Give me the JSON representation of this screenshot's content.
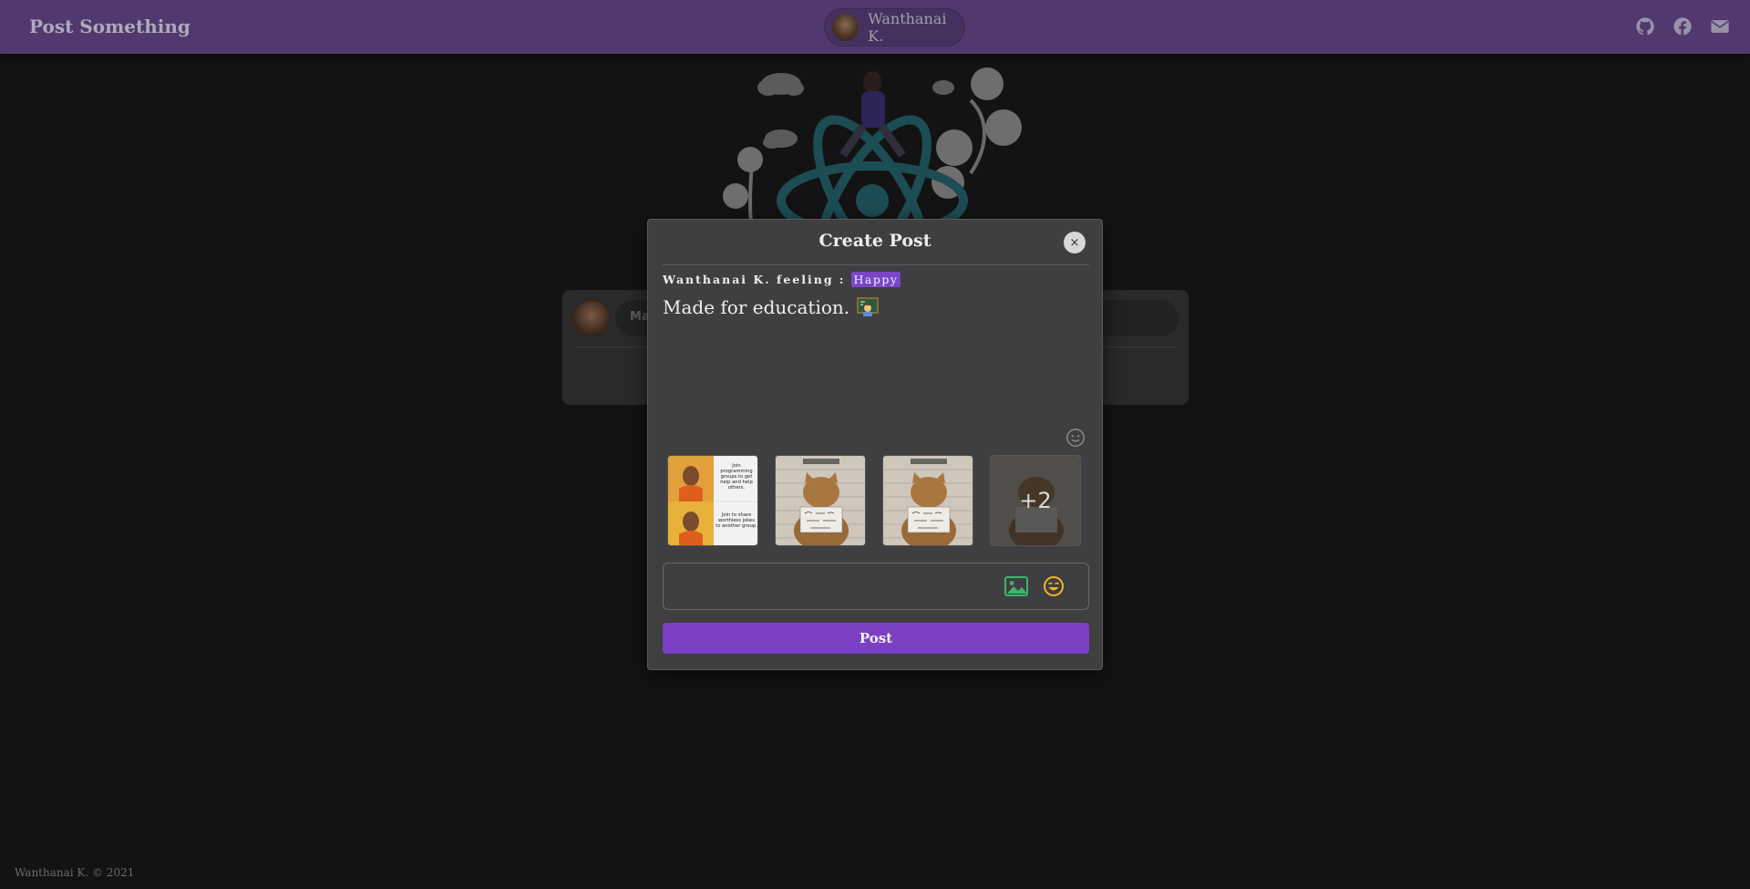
{
  "header": {
    "brand": "Post Something",
    "user_name": "Wanthanai K.",
    "icons": [
      "github-icon",
      "facebook-icon",
      "mail-icon"
    ]
  },
  "background_card": {
    "input_placeholder": "Ma"
  },
  "modal": {
    "title": "Create Post",
    "close_label": "×",
    "feeling_prefix": "Wanthanai K. feeling :",
    "feeling_value": "Happy",
    "post_text": "Made for education.",
    "post_emoji": "teacher-emoji",
    "thumbnails": [
      {
        "name": "drake-meme",
        "caption_top": "Join programming groups to get help and help others.",
        "caption_bottom": "Join to share worthless jokes to another group."
      },
      {
        "name": "cat-mugshot-1"
      },
      {
        "name": "cat-mugshot-2"
      },
      {
        "name": "cat-mugshot-3",
        "more_count": "+2"
      }
    ],
    "add_bar_icons": [
      "image-icon",
      "feeling-icon"
    ],
    "post_button": "Post"
  },
  "footer": {
    "copyright": "Wanthanai K. © 2021"
  },
  "colors": {
    "header_bg": "#51396f",
    "accent": "#7b3fc4",
    "page_bg": "#131313",
    "modal_bg": "#3f3e40"
  }
}
